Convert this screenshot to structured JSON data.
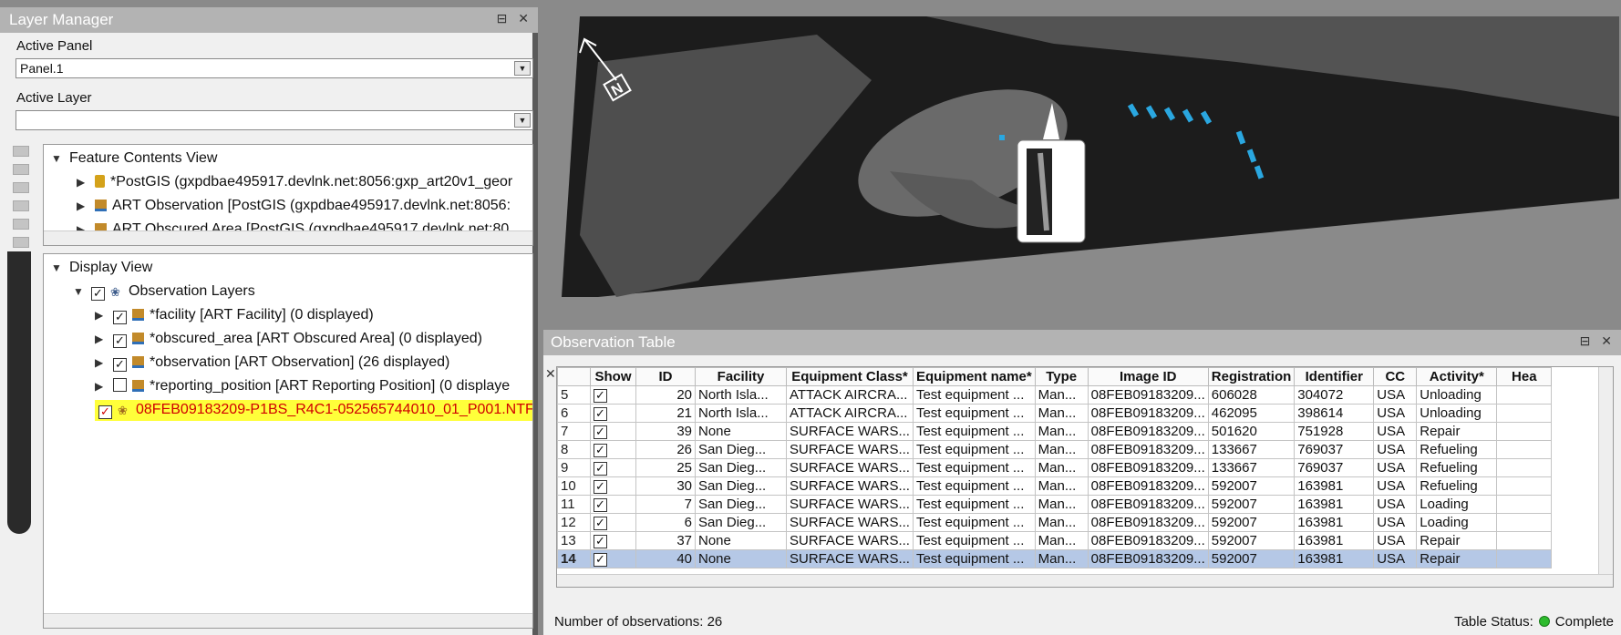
{
  "layer_manager": {
    "title": "Layer Manager",
    "window_controls": "⊟ ✕",
    "active_panel_label": "Active Panel",
    "active_panel_value": "Panel.1",
    "active_layer_label": "Active Layer",
    "active_layer_value": "",
    "feature_contents": {
      "header": "Feature Contents View",
      "items": [
        "*PostGIS (gxpdbae495917.devlnk.net:8056:gxp_art20v1_geor",
        "ART Observation  [PostGIS (gxpdbae495917.devlnk.net:8056:",
        "ART Obscured Area  [PostGIS (gxpdbae495917.devlnk.net:80"
      ]
    },
    "display_view": {
      "header": "Display View",
      "group": "Observation Layers",
      "layers": [
        "*facility [ART Facility]  (0 displayed)",
        "*obscured_area [ART Obscured Area]  (0 displayed)",
        "*observation [ART Observation]  (26 displayed)",
        "*reporting_position [ART Reporting Position]  (0 displaye"
      ],
      "image_layer": "08FEB09183209-P1BS_R4C1-052565744010_01_P001.NTF ("
    }
  },
  "map": {
    "north_label": "N",
    "accent": "#2aa7e0"
  },
  "observation_table": {
    "title": "Observation Table",
    "window_controls": "⊟ ✕",
    "columns": [
      "Show",
      "ID",
      "Facility",
      "Equipment Class*",
      "Equipment name*",
      "Type",
      "Image ID",
      "Registration",
      "Identifier",
      "CC",
      "Activity*",
      "Hea"
    ],
    "column_display": [
      "Show",
      "ID",
      "Facility",
      "Equipment Class*",
      "Equipment name*",
      "Type",
      "Image ID",
      "Registration",
      "Identifier",
      "CC",
      "Activity*",
      "Hea"
    ],
    "rows": [
      {
        "row": "5",
        "id": "20",
        "facility": "North Isla...",
        "eq_class": "ATTACK AIRCRA...",
        "eq_name": "Test equipment ...",
        "type": "Man...",
        "image_id": "08FEB09183209...",
        "registration": "606028",
        "identifier": "304072",
        "cc": "USA",
        "activity": "Unloading"
      },
      {
        "row": "6",
        "id": "21",
        "facility": "North Isla...",
        "eq_class": "ATTACK AIRCRA...",
        "eq_name": "Test equipment ...",
        "type": "Man...",
        "image_id": "08FEB09183209...",
        "registration": "462095",
        "identifier": "398614",
        "cc": "USA",
        "activity": "Unloading"
      },
      {
        "row": "7",
        "id": "39",
        "facility": "None",
        "eq_class": "SURFACE WARS...",
        "eq_name": "Test equipment ...",
        "type": "Man...",
        "image_id": "08FEB09183209...",
        "registration": "501620",
        "identifier": "751928",
        "cc": "USA",
        "activity": "Repair"
      },
      {
        "row": "8",
        "id": "26",
        "facility": "San Dieg...",
        "eq_class": "SURFACE WARS...",
        "eq_name": "Test equipment ...",
        "type": "Man...",
        "image_id": "08FEB09183209...",
        "registration": "133667",
        "identifier": "769037",
        "cc": "USA",
        "activity": "Refueling"
      },
      {
        "row": "9",
        "id": "25",
        "facility": "San Dieg...",
        "eq_class": "SURFACE WARS...",
        "eq_name": "Test equipment ...",
        "type": "Man...",
        "image_id": "08FEB09183209...",
        "registration": "133667",
        "identifier": "769037",
        "cc": "USA",
        "activity": "Refueling"
      },
      {
        "row": "10",
        "id": "30",
        "facility": "San Dieg...",
        "eq_class": "SURFACE WARS...",
        "eq_name": "Test equipment ...",
        "type": "Man...",
        "image_id": "08FEB09183209...",
        "registration": "592007",
        "identifier": "163981",
        "cc": "USA",
        "activity": "Refueling"
      },
      {
        "row": "11",
        "id": "7",
        "facility": "San Dieg...",
        "eq_class": "SURFACE WARS...",
        "eq_name": "Test equipment ...",
        "type": "Man...",
        "image_id": "08FEB09183209...",
        "registration": "592007",
        "identifier": "163981",
        "cc": "USA",
        "activity": "Loading"
      },
      {
        "row": "12",
        "id": "6",
        "facility": "San Dieg...",
        "eq_class": "SURFACE WARS...",
        "eq_name": "Test equipment ...",
        "type": "Man...",
        "image_id": "08FEB09183209...",
        "registration": "592007",
        "identifier": "163981",
        "cc": "USA",
        "activity": "Loading"
      },
      {
        "row": "13",
        "id": "37",
        "facility": "None",
        "eq_class": "SURFACE WARS...",
        "eq_name": "Test equipment ...",
        "type": "Man...",
        "image_id": "08FEB09183209...",
        "registration": "592007",
        "identifier": "163981",
        "cc": "USA",
        "activity": "Repair"
      },
      {
        "row": "14",
        "id": "40",
        "facility": "None",
        "eq_class": "SURFACE WARS...",
        "eq_name": "Test equipment ...",
        "type": "Man...",
        "image_id": "08FEB09183209...",
        "registration": "592007",
        "identifier": "163981",
        "cc": "USA",
        "activity": "Repair",
        "selected": true
      }
    ],
    "footer_left_label": "Number of observations: 26",
    "status_label": "Table Status:",
    "status_value": "Complete",
    "status_color": "#2dbb2d",
    "selection_color": "#b5c8e6"
  }
}
